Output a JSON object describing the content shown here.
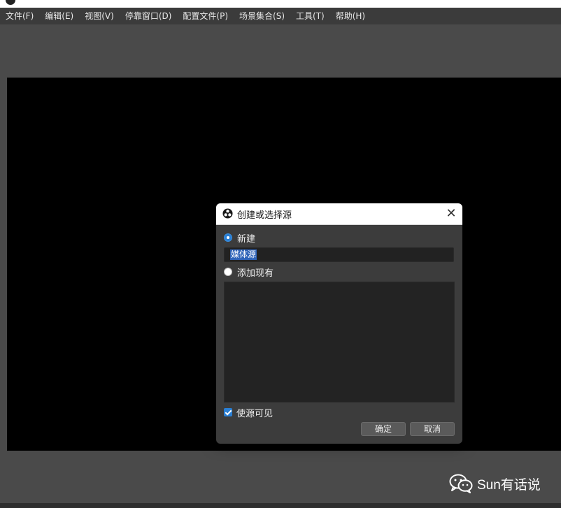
{
  "menu": {
    "items": [
      "文件(F)",
      "编辑(E)",
      "视图(V)",
      "停靠窗口(D)",
      "配置文件(P)",
      "场景集合(S)",
      "工具(T)",
      "帮助(H)"
    ]
  },
  "dialog": {
    "title": "创建或选择源",
    "new_label": "新建",
    "name_value": "媒体源",
    "existing_label": "添加现有",
    "visible_label": "使源可见",
    "ok_label": "确定",
    "cancel_label": "取消",
    "close_glyph": "✕",
    "new_selected": true,
    "visible_checked": true
  },
  "watermark": {
    "text": "Sun有话说",
    "icon": "wechat-icon"
  },
  "colors": {
    "accent": "#2a7fd4",
    "dialog_bg": "#3c3c3c",
    "preview_bg": "#000000",
    "menubar_bg": "#3b3b3b"
  }
}
